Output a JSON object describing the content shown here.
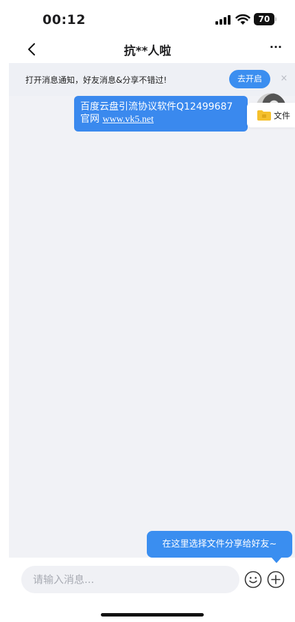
{
  "status_bar": {
    "time": "00:12",
    "battery": "70"
  },
  "nav": {
    "title": "抗**人啦",
    "more": "···"
  },
  "notice": {
    "text": "打开消息通知，好友消息&分享不错过!",
    "open_label": "去开启",
    "close_label": "×"
  },
  "message": {
    "line1": "百度云盘引流协议软件Q12499687",
    "line2_prefix": "官网 ",
    "link": "www.vk5.net"
  },
  "file_chip": {
    "label": "文件"
  },
  "tooltip": {
    "text": "在这里选择文件分享给好友~"
  },
  "input": {
    "placeholder": "请输入消息..."
  },
  "colors": {
    "accent": "#3a8ef0",
    "chat_bg": "#f1f2f6"
  }
}
